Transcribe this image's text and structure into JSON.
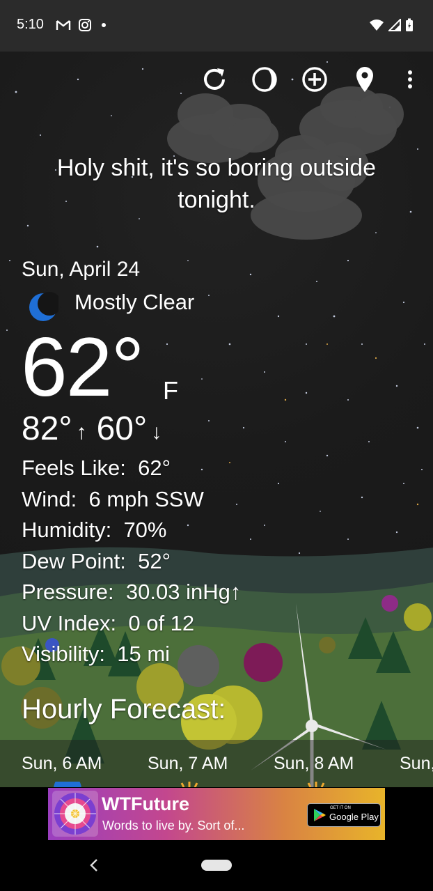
{
  "status_bar": {
    "time": "5:10"
  },
  "toolbar": {
    "icons": [
      "refresh-icon",
      "moon-phase-icon",
      "add-location-icon",
      "location-pin-icon",
      "more-vert-icon"
    ]
  },
  "headline": "Holy shit, it's so boring outside tonight.",
  "current": {
    "date": "Sun, April 24",
    "condition": "Mostly Clear",
    "temperature": "62°",
    "unit": "F",
    "high": "82°",
    "low": "60°",
    "details": [
      {
        "label": "Feels Like:",
        "value": "62°"
      },
      {
        "label": "Wind:",
        "value": "6 mph SSW"
      },
      {
        "label": "Humidity:",
        "value": "70%"
      },
      {
        "label": "Dew Point:",
        "value": "52°"
      },
      {
        "label": "Pressure:",
        "value": "30.03 inHg↑"
      },
      {
        "label": "UV Index:",
        "value": "0 of 12"
      },
      {
        "label": "Visibility:",
        "value": "15 mi"
      }
    ]
  },
  "hourly": {
    "title": "Hourly Forecast:",
    "items": [
      "Sun, 6 AM",
      "Sun, 7 AM",
      "Sun, 8 AM",
      "Sun,"
    ]
  },
  "ad": {
    "title": "WTFuture",
    "subtitle": "Words to live by.  Sort of...",
    "store_small": "GET IT ON",
    "store_big": "Google Play"
  }
}
